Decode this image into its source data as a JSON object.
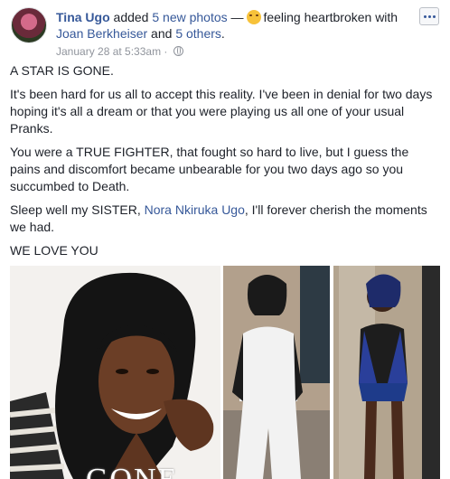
{
  "post": {
    "author": "Tina Ugo",
    "added_prefix": " added ",
    "added_photos": "5 new photos",
    "dash": " — ",
    "feeling": "feeling heartbroken with",
    "tagged_person": "Joan Berkheiser",
    "and_text": " and ",
    "others": "5 others",
    "period": ".",
    "date": "January 28 at 5:33am",
    "separator": " · ",
    "feeling_icon": "sad-face-emoji",
    "privacy_icon": "globe-icon"
  },
  "body": {
    "p1": "A STAR IS GONE.",
    "p2": "It's been hard for us all to accept this reality. I've been in denial for two days hoping it's all a dream or that you were playing us all one of your usual Pranks.",
    "p3": "You were a TRUE FIGHTER, that fought so hard to live, but I guess the pains and discomfort became unbearable for you two days ago so you succumbed to Death.",
    "p4_before": "Sleep well my SISTER, ",
    "p4_link": "Nora Nkiruka Ugo",
    "p4_after": ", I'll forever cherish the moments we had.",
    "p5": "WE LOVE YOU"
  },
  "photos": {
    "photo1_caption": "GONE"
  },
  "colors": {
    "link": "#365899",
    "text": "#1d2129",
    "meta": "#90949c"
  }
}
